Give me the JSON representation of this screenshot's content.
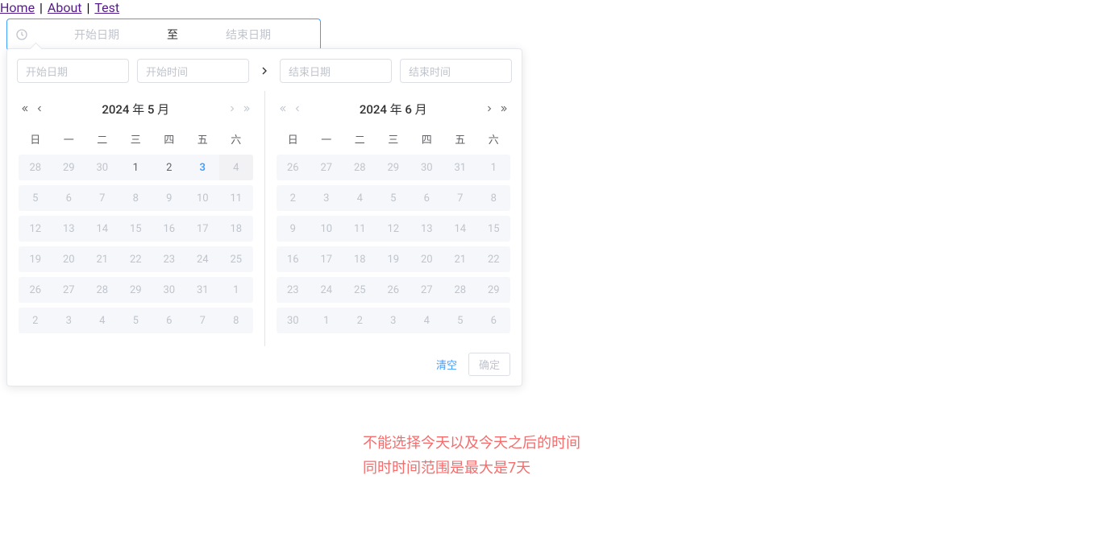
{
  "nav": {
    "home": "Home",
    "about": "About",
    "test": "Test"
  },
  "rangeInput": {
    "start_ph": "开始日期",
    "mid": "至",
    "end_ph": "结束日期"
  },
  "popHeader": {
    "start_date_ph": "开始日期",
    "start_time_ph": "开始时间",
    "end_date_ph": "结束日期",
    "end_time_ph": "结束时间"
  },
  "weekdays": [
    "日",
    "一",
    "二",
    "三",
    "四",
    "五",
    "六"
  ],
  "leftPanel": {
    "title": "2024 年 5 月",
    "rows": [
      [
        {
          "d": "28"
        },
        {
          "d": "29"
        },
        {
          "d": "30"
        },
        {
          "d": "1",
          "en": true
        },
        {
          "d": "2",
          "en": true
        },
        {
          "d": "3",
          "today": true
        },
        {
          "d": "4",
          "hover": true
        }
      ],
      [
        {
          "d": "5"
        },
        {
          "d": "6"
        },
        {
          "d": "7"
        },
        {
          "d": "8"
        },
        {
          "d": "9"
        },
        {
          "d": "10"
        },
        {
          "d": "11"
        }
      ],
      [
        {
          "d": "12"
        },
        {
          "d": "13"
        },
        {
          "d": "14"
        },
        {
          "d": "15"
        },
        {
          "d": "16"
        },
        {
          "d": "17"
        },
        {
          "d": "18"
        }
      ],
      [
        {
          "d": "19"
        },
        {
          "d": "20"
        },
        {
          "d": "21"
        },
        {
          "d": "22"
        },
        {
          "d": "23"
        },
        {
          "d": "24"
        },
        {
          "d": "25"
        }
      ],
      [
        {
          "d": "26"
        },
        {
          "d": "27"
        },
        {
          "d": "28"
        },
        {
          "d": "29"
        },
        {
          "d": "30"
        },
        {
          "d": "31"
        },
        {
          "d": "1"
        }
      ],
      [
        {
          "d": "2"
        },
        {
          "d": "3"
        },
        {
          "d": "4"
        },
        {
          "d": "5"
        },
        {
          "d": "6"
        },
        {
          "d": "7"
        },
        {
          "d": "8"
        }
      ]
    ]
  },
  "rightPanel": {
    "title": "2024 年 6 月",
    "rows": [
      [
        {
          "d": "26"
        },
        {
          "d": "27"
        },
        {
          "d": "28"
        },
        {
          "d": "29"
        },
        {
          "d": "30"
        },
        {
          "d": "31"
        },
        {
          "d": "1"
        }
      ],
      [
        {
          "d": "2"
        },
        {
          "d": "3"
        },
        {
          "d": "4"
        },
        {
          "d": "5"
        },
        {
          "d": "6"
        },
        {
          "d": "7"
        },
        {
          "d": "8"
        }
      ],
      [
        {
          "d": "9"
        },
        {
          "d": "10"
        },
        {
          "d": "11"
        },
        {
          "d": "12"
        },
        {
          "d": "13"
        },
        {
          "d": "14"
        },
        {
          "d": "15"
        }
      ],
      [
        {
          "d": "16"
        },
        {
          "d": "17"
        },
        {
          "d": "18"
        },
        {
          "d": "19"
        },
        {
          "d": "20"
        },
        {
          "d": "21"
        },
        {
          "d": "22"
        }
      ],
      [
        {
          "d": "23"
        },
        {
          "d": "24"
        },
        {
          "d": "25"
        },
        {
          "d": "26"
        },
        {
          "d": "27"
        },
        {
          "d": "28"
        },
        {
          "d": "29"
        }
      ],
      [
        {
          "d": "30"
        },
        {
          "d": "1"
        },
        {
          "d": "2"
        },
        {
          "d": "3"
        },
        {
          "d": "4"
        },
        {
          "d": "5"
        },
        {
          "d": "6"
        }
      ]
    ]
  },
  "footer": {
    "clear": "清空",
    "ok": "确定"
  },
  "notes": {
    "line1": "不能选择今天以及今天之后的时间",
    "line2": "同时时间范围是最大是7天"
  }
}
